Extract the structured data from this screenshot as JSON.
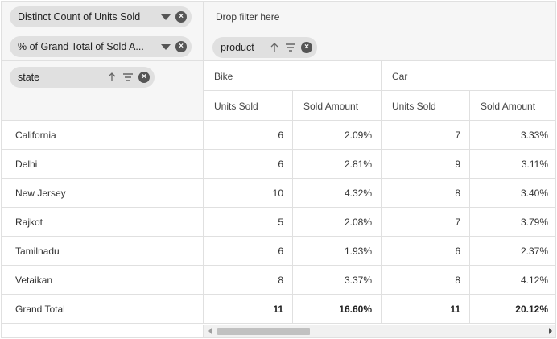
{
  "values_pills": [
    {
      "label": "Distinct Count of Units Sold"
    },
    {
      "label": "% of Grand Total of Sold A..."
    }
  ],
  "filter_area": {
    "placeholder": "Drop filter here"
  },
  "column_pill": {
    "label": "product"
  },
  "row_pill": {
    "label": "state"
  },
  "products": [
    "Bike",
    "Car"
  ],
  "measures": [
    "Units Sold",
    "Sold Amount",
    "Units Sold",
    "Sold Amount"
  ],
  "rows": [
    {
      "name": "California",
      "values": [
        "6",
        "2.09%",
        "7",
        "3.33%"
      ]
    },
    {
      "name": "Delhi",
      "values": [
        "6",
        "2.81%",
        "9",
        "3.11%"
      ]
    },
    {
      "name": "New Jersey",
      "values": [
        "10",
        "4.32%",
        "8",
        "3.40%"
      ]
    },
    {
      "name": "Rajkot",
      "values": [
        "5",
        "2.08%",
        "7",
        "3.79%"
      ]
    },
    {
      "name": "Tamilnadu",
      "values": [
        "6",
        "1.93%",
        "6",
        "2.37%"
      ]
    },
    {
      "name": "Vetaikan",
      "values": [
        "8",
        "3.37%",
        "8",
        "4.12%"
      ]
    }
  ],
  "grand_total": {
    "name": "Grand Total",
    "values": [
      "11",
      "16.60%",
      "11",
      "20.12%"
    ]
  },
  "colors": {
    "pill_bg": "#e0e0e0",
    "header_bg": "#f6f6f6",
    "border": "#e0e0e0",
    "icon": "#555555"
  }
}
